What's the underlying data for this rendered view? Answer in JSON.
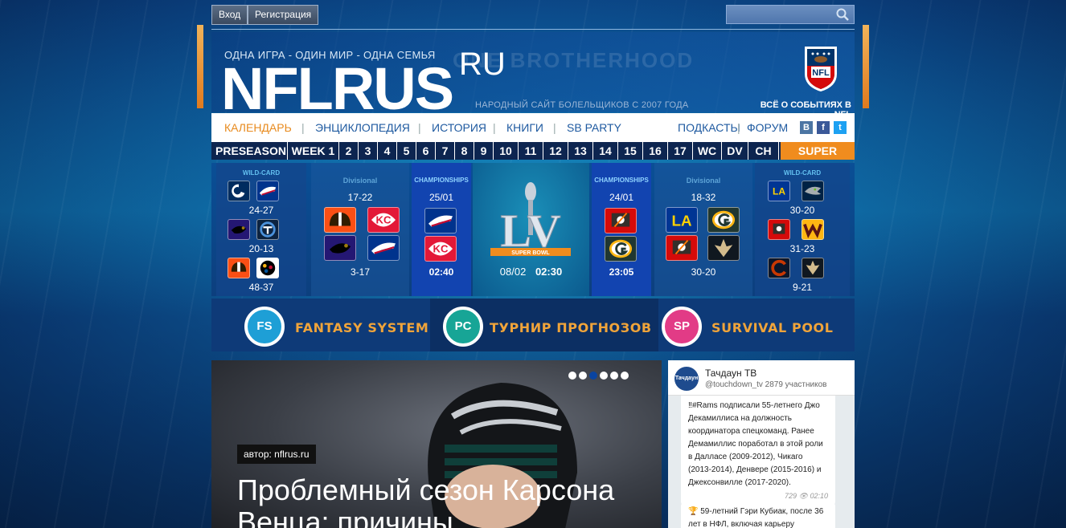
{
  "topbar": {
    "login_label": "Вход",
    "register_label": "Регистрация"
  },
  "header": {
    "tagline": "ОДНА ИГРА - ОДИН МИР - ОДНА СЕМЬЯ",
    "logo_main": "NFLRUS",
    "logo_suffix": "RU",
    "fan_site": "НАРОДНЫЙ САЙТ БОЛЕЛЬЩИКОВ С 2007 ГОДА",
    "nfl_news": "ВСЁ О СОБЫТИЯХ В NFL",
    "nfl_badge": "NFL"
  },
  "mainnav": {
    "items": [
      "КАЛЕНДАРЬ",
      "ЭНЦИКЛОПЕДИЯ",
      "ИСТОРИЯ",
      "КНИГИ",
      "SB PARTY"
    ],
    "right_items": [
      "ПОДКАСТЫ",
      "ФОРУМ"
    ],
    "social": [
      "В",
      "f",
      "t"
    ]
  },
  "weeknav": {
    "items": [
      "PRESEASON",
      "WEEK 1",
      "2",
      "3",
      "4",
      "5",
      "6",
      "7",
      "8",
      "9",
      "10",
      "11",
      "12",
      "13",
      "14",
      "15",
      "16",
      "17",
      "WC",
      "DV",
      "CH",
      "SUPER BOWL"
    ]
  },
  "bracket": {
    "left_wild": {
      "heading": "WILD-CARD",
      "scores": [
        "24-27",
        "20-13",
        "48-37"
      ]
    },
    "left_div": {
      "heading": "Divisional",
      "scores": [
        "17-22",
        "3-17"
      ]
    },
    "left_champ": {
      "heading": "CHAMPIONSHIPS",
      "date": "25/01",
      "time": "02:40"
    },
    "superbowl": {
      "roman": "LV",
      "ribbon": "SUPER BOWL",
      "date": "08/02",
      "time": "02:30"
    },
    "right_champ": {
      "heading": "CHAMPIONSHIPS",
      "date": "24/01",
      "time": "23:05"
    },
    "right_div": {
      "heading": "Divisional",
      "scores": [
        "18-32",
        "30-20"
      ]
    },
    "right_wild": {
      "heading": "WILD-CARD",
      "scores": [
        "30-20",
        "31-23",
        "9-21"
      ]
    }
  },
  "fantasy": {
    "items": [
      {
        "badge": "FS",
        "label": "FANTASY SYSTEM",
        "color": "#1e9fd6"
      },
      {
        "badge": "PC",
        "label": "ТУРНИР ПРОГНОЗОВ",
        "color": "#17a596"
      },
      {
        "badge": "SP",
        "label": "SURVIVAL POOL",
        "color": "#e23b86"
      }
    ]
  },
  "hero": {
    "author": "автор: nflrus.ru",
    "title": "Проблемный сезон Карсона Венца: причины",
    "slides": 6,
    "active_slide": 3
  },
  "telegram": {
    "avatar_text": "Тачдаун",
    "name": "Тачдаун ТВ",
    "subtitle": "@touchdown_tv 2879 участников",
    "msg1": "‼#Rams подписали 55-летнего Джо Декамиллиса на должность координатора спецкоманд. Ранее Демамиллис поработал в этой роли в Далласе (2009-2012), Чикаго (2013-2014), Денвере (2015-2016) и Джексонвилле (2017-2020).",
    "msg1_meta": "729 👁 02:10",
    "msg2": "🏆 59-летний Гэри Кубиак, после 36 лет в НФЛ, включая карьеру"
  },
  "colors": {
    "accent": "#f08c1e",
    "nav_text": "#1f5aa0",
    "week_bg": "#0d2550"
  }
}
